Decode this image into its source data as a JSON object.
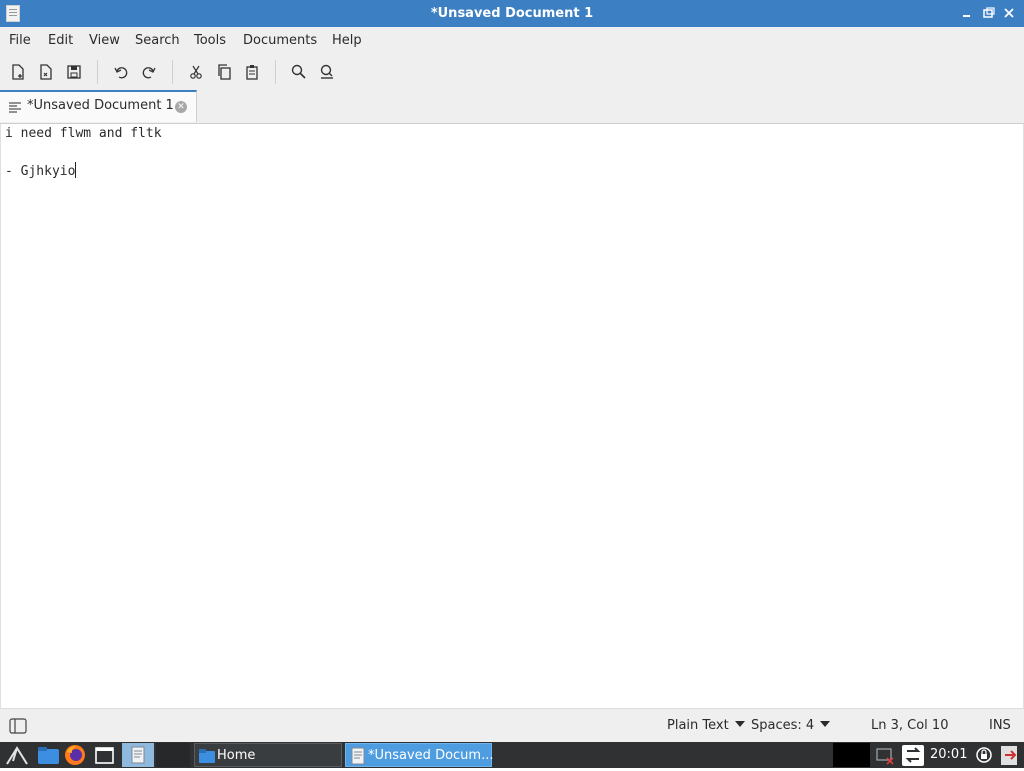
{
  "window": {
    "title": "*Unsaved Document 1",
    "controls": [
      "minimize-icon",
      "maximize-icon",
      "close-icon"
    ]
  },
  "menu": {
    "items": [
      "File",
      "Edit",
      "View",
      "Search",
      "Tools",
      "Documents",
      "Help"
    ]
  },
  "toolbar": {
    "icons": [
      "new-document-icon",
      "open-document-icon",
      "save-icon",
      "undo-icon",
      "redo-icon",
      "cut-icon",
      "copy-icon",
      "paste-icon",
      "find-icon",
      "find-replace-icon"
    ]
  },
  "tab": {
    "label": "*Unsaved Document 1",
    "close_icon": "tab-close-icon"
  },
  "editor": {
    "lines": [
      "i need flwm and fltk",
      "",
      "- Gjhkyio"
    ]
  },
  "status": {
    "language": "Plain Text",
    "indent": "Spaces: 4",
    "position": "Ln 3, Col 10",
    "mode": "INS"
  },
  "taskbar": {
    "home_label": "Home",
    "active_window_label": "*Unsaved Docum...",
    "clock": "20:01"
  },
  "colors": {
    "titlebar": "#3c7fc3",
    "accent": "#3c7fc3",
    "taskbar": "#2f3133"
  }
}
